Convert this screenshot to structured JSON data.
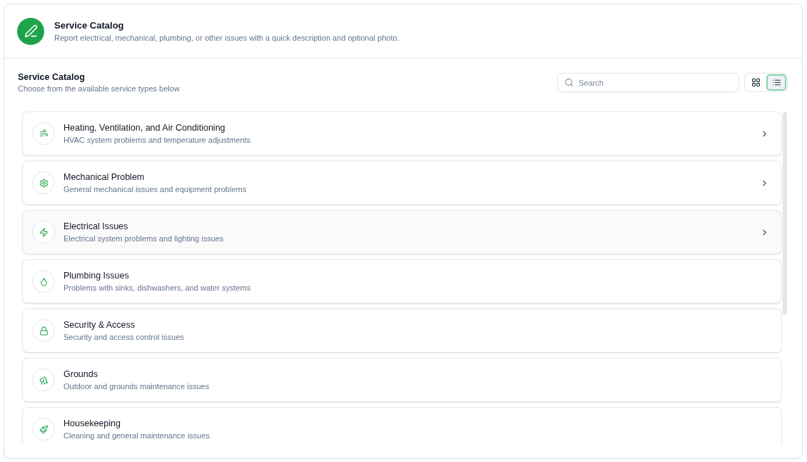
{
  "header": {
    "title": "Service Catalog",
    "subtitle": "Report electrical, mechanical, plumbing, or other issues with a quick description and optional photo."
  },
  "section": {
    "title": "Service Catalog",
    "subtitle": "Choose from the available service types below"
  },
  "search": {
    "placeholder": "Search"
  },
  "view_toggle": [
    {
      "kind": "grid",
      "selected": false
    },
    {
      "kind": "list",
      "selected": true
    }
  ],
  "services": [
    {
      "title": "Heating, Ventilation, and Air Conditioning",
      "description": "HVAC system problems and temperature adjustments",
      "hovered": false,
      "chevron": true
    },
    {
      "title": "Mechanical Problem",
      "description": "General mechanical issues and equipment problems",
      "hovered": false,
      "chevron": true
    },
    {
      "title": "Electrical Issues",
      "description": "Electrical system problems and lighting issues",
      "hovered": true,
      "chevron": true
    },
    {
      "title": "Plumbing Issues",
      "description": "Problems with sinks, dishwashers, and water systems",
      "hovered": false,
      "chevron": false
    },
    {
      "title": "Security & Access",
      "description": "Security and access control issues",
      "hovered": false,
      "chevron": false
    },
    {
      "title": "Grounds",
      "description": "Outdoor and grounds maintenance issues",
      "hovered": false,
      "chevron": false
    },
    {
      "title": "Housekeeping",
      "description": "Cleaning and general maintenance issues",
      "hovered": false,
      "chevron": false
    }
  ]
}
